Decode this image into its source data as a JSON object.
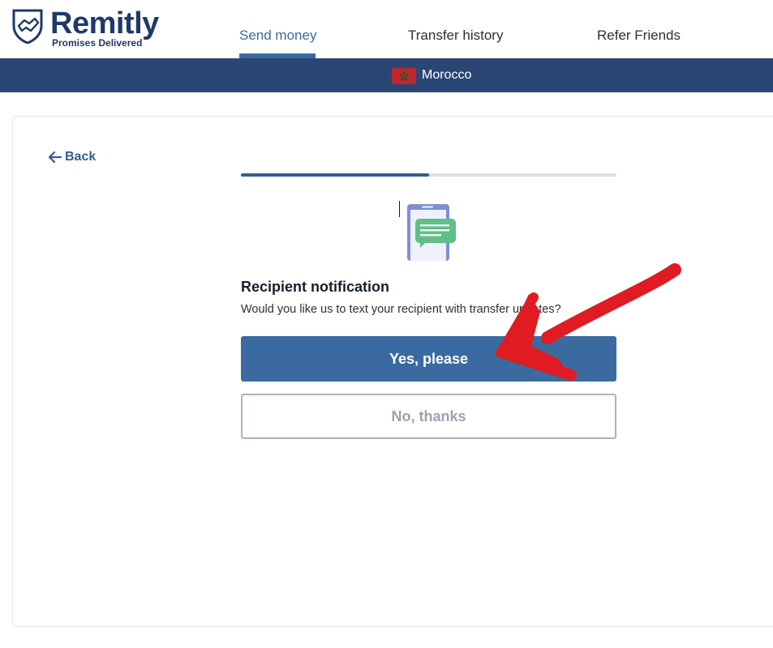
{
  "brand": {
    "name": "Remitly",
    "tagline": "Promises Delivered",
    "color": "#1f3a68"
  },
  "nav": {
    "tabs": [
      {
        "label": "Send money",
        "active": true
      },
      {
        "label": "Transfer history",
        "active": false
      },
      {
        "label": "Refer Friends",
        "active": false
      }
    ]
  },
  "country_bar": {
    "country": "Morocco",
    "background": "#2a4675"
  },
  "back": {
    "label": "Back",
    "icon": "arrow-left-icon"
  },
  "progress": {
    "fraction": 0.5
  },
  "notification": {
    "title": "Recipient notification",
    "question": "Would you like us to text your recipient with transfer updates?",
    "yes_label": "Yes, please",
    "no_label": "No, thanks"
  },
  "annotation": {
    "icon": "red-arrow-icon",
    "color": "#e11b22"
  }
}
